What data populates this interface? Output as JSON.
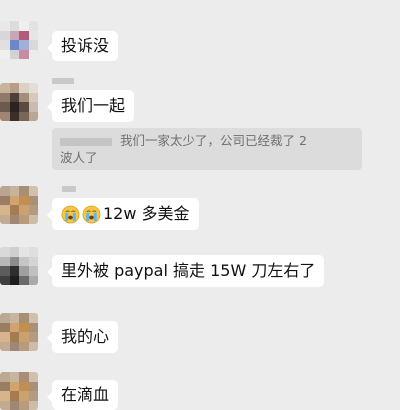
{
  "messages": [
    {
      "text": "投诉没"
    },
    {
      "text": "我们一起"
    },
    {
      "text": "12w 多美金",
      "emojis": [
        "crying-face",
        "crying-face"
      ]
    },
    {
      "text": "里外被 paypal 搞走 15W 刀左右了"
    },
    {
      "text": "我的心"
    },
    {
      "text": "在滴血"
    }
  ],
  "quote": {
    "line1": "我们一家太少了，公司已经裁了 2",
    "line2": "波人了"
  },
  "colors": {
    "background": "#ececec",
    "bubble": "#ffffff",
    "quote_background": "#dcdcdc",
    "quote_text": "#6f6f6f"
  }
}
